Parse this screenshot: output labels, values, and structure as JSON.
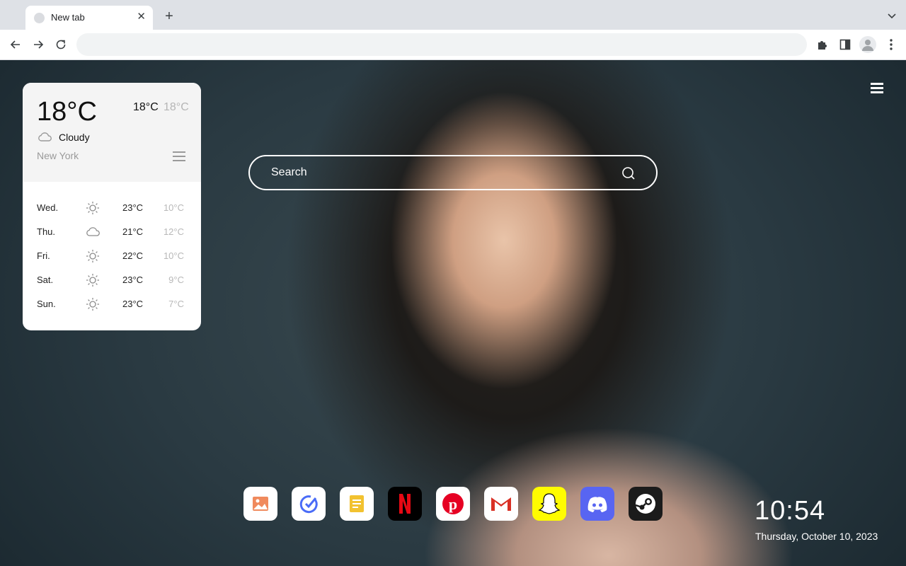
{
  "browser": {
    "tab_title": "New tab",
    "tab_close_glyph": "✕",
    "new_tab_glyph": "+",
    "address_value": ""
  },
  "weather": {
    "current_temp": "18°C",
    "high": "18°C",
    "low": "18°C",
    "condition": "Cloudy",
    "condition_icon": "cloud-icon",
    "city": "New York",
    "forecast": [
      {
        "day": "Wed.",
        "icon": "sun-icon",
        "high": "23°C",
        "low": "10°C"
      },
      {
        "day": "Thu.",
        "icon": "cloud-icon",
        "high": "21°C",
        "low": "12°C"
      },
      {
        "day": "Fri.",
        "icon": "sun-icon",
        "high": "22°C",
        "low": "10°C"
      },
      {
        "day": "Sat.",
        "icon": "sun-icon",
        "high": "23°C",
        "low": "9°C"
      },
      {
        "day": "Sun.",
        "icon": "sun-icon",
        "high": "23°C",
        "low": "7°C"
      }
    ]
  },
  "search": {
    "placeholder": "Search"
  },
  "dock": [
    {
      "name": "wallpaper-gallery-icon",
      "bg": "#ffffff",
      "accent": "#f08a5d"
    },
    {
      "name": "task-check-icon",
      "bg": "#ffffff",
      "accent": "#4a6cf7"
    },
    {
      "name": "notes-icon",
      "bg": "#ffffff",
      "accent": "#f2c230"
    },
    {
      "name": "netflix-icon",
      "bg": "#000000",
      "accent": "#e50914"
    },
    {
      "name": "pinterest-icon",
      "bg": "#ffffff",
      "accent": "#e60023"
    },
    {
      "name": "gmail-icon",
      "bg": "#ffffff",
      "accent": "#d93025"
    },
    {
      "name": "snapchat-icon",
      "bg": "#fffc00",
      "accent": "#ffffff"
    },
    {
      "name": "discord-icon",
      "bg": "#5865f2",
      "accent": "#ffffff"
    },
    {
      "name": "steam-icon",
      "bg": "#1b1b1b",
      "accent": "#ffffff"
    }
  ],
  "clock": {
    "time": "10:54",
    "date": "Thursday, October 10, 2023"
  }
}
